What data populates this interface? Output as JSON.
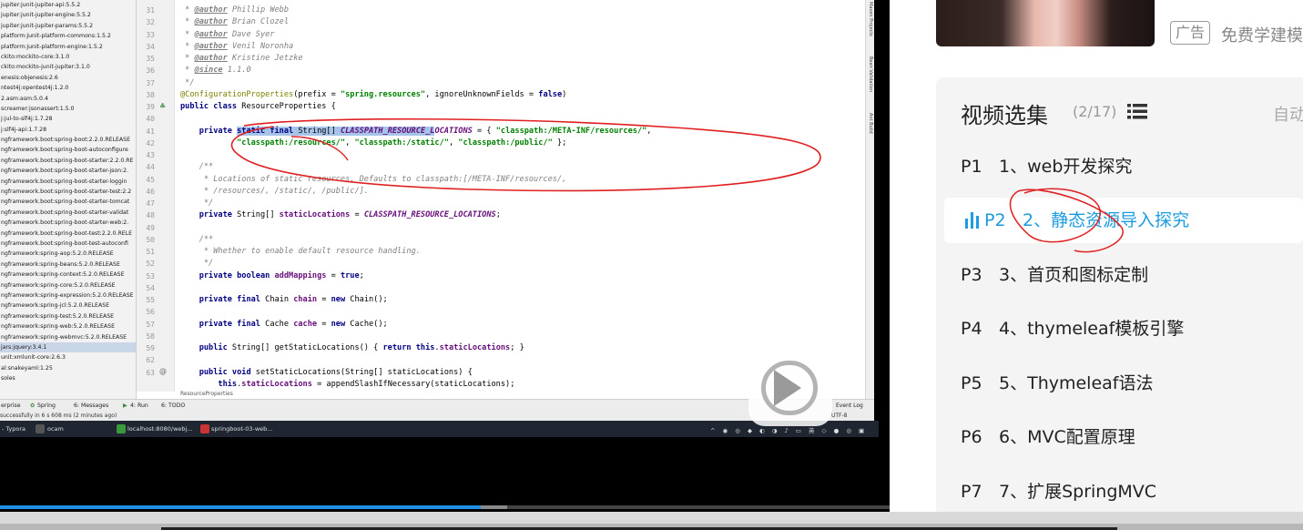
{
  "project_libraries": [
    "jupiter:junit-jupiter-api:5.5.2",
    "jupiter:junit-jupiter-engine:5.5.2",
    "jupiter:junit-jupiter-params:5.5.2",
    "platform:junit-platform-commons:1.5.2",
    "platform:junit-platform-engine:1.5.2",
    "ckito:mockito-core:3.1.0",
    "ckito:mockito-junit-jupiter:3.1.0",
    "enesis:objenesis:2.6",
    "ntest4j:opentest4j:1.2.0",
    "2.asm:asm:5.0.4",
    "screamer:jsonassert:1.5.0",
    "j:jul-to-slf4j:1.7.28",
    "j:slf4j-api:1.7.28",
    "ngframework.boot:spring-boot:2.2.0.RELEASE",
    "ngframework.boot:spring-boot-autoconfigure",
    "ngframework.boot:spring-boot-starter:2.2.0.RE",
    "ngframework.boot:spring-boot-starter-json:2.",
    "ngframework.boot:spring-boot-starter-loggin",
    "ngframework.boot:spring-boot-starter-test:2.2",
    "ngframework.boot:spring-boot-starter-tomcat",
    "ngframework.boot:spring-boot-starter-validat",
    "ngframework.boot:spring-boot-starter-web:2.",
    "ngframework.boot:spring-boot-test:2.2.0.RELE",
    "ngframework.boot:spring-boot-test-autoconfi",
    "ngframework:spring-aop:5.2.0.RELEASE",
    "ngframework:spring-beans:5.2.0.RELEASE",
    "ngframework:spring-context:5.2.0.RELEASE",
    "ngframework:spring-core:5.2.0.RELEASE",
    "ngframework:spring-expression:5.2.0.RELEASE",
    "ngframework:spring-jcl:5.2.0.RELEASE",
    "ngframework:spring-test:5.2.0.RELEASE",
    "ngframework:spring-web:5.2.0.RELEASE",
    "ngframework:spring-webmvc:5.2.0.RELEASE",
    "jars:jquery:3.4.1",
    "unit:xmlunit-core:2.6.3",
    "al:snakeyaml:1.25",
    "soles"
  ],
  "editor": {
    "line_numbers": [
      "31",
      "32",
      "33",
      "34",
      "35",
      "36",
      "37",
      "38",
      "39",
      "40",
      "41",
      "42",
      "43",
      "44",
      "45",
      "46",
      "47",
      "48",
      "49",
      "50",
      "51",
      "52",
      "53",
      "54",
      "55",
      "56",
      "57",
      "58",
      "59",
      "62",
      "63"
    ],
    "authors": [
      "Phillip Webb",
      "Brian Clozel",
      "Dave Syer",
      "Venil Noronha",
      "Kristine Jetzke"
    ],
    "author_tag": "@author",
    "since_tag": "@since",
    "since_value": "1.1.0",
    "annotation": "@ConfigurationProperties",
    "prefix_value": "\"spring.resources\"",
    "class_name": "ResourceProperties",
    "constant": "CLASSPATH_RESOURCE_LOCATIONS",
    "loc1": "\"classpath:/META-INF/resources/\"",
    "loc2": "\"classpath:/resources/\"",
    "loc3": "\"classpath:/static/\"",
    "loc4": "\"classpath:/public/\"",
    "doc1": " * Locations of static resources. Defaults to classpath:[/META-INF/resources/,",
    "doc2": " * /resources/, /static/, /public/].",
    "doc3": " * Whether to enable default resource handling.",
    "breadcrumb": "ResourceProperties"
  },
  "ide_toolbar": {
    "items": [
      "erprise",
      "Spring",
      "6: Messages",
      "4: Run",
      "6: TODO"
    ],
    "event_log": "Event Log",
    "status": "successfully in 6 s 608 ms (2 minutes ago)",
    "encoding": "UTF-8"
  },
  "side_tabs": [
    "Maven Projects",
    "Bean Validation",
    "Ant Build"
  ],
  "taskbar": {
    "items": [
      "- Typora",
      "ocam",
      "localhost:8080/webj...",
      "springboot-03-web..."
    ]
  },
  "player": {
    "progress": 0.54,
    "buffered": 0.57
  },
  "ad": {
    "badge": "广告",
    "text": "免费学建模"
  },
  "playlist": {
    "title": "视频选集",
    "count": "(2/17)",
    "auto": "自动",
    "episodes": [
      {
        "p": "P1",
        "title": "1、web开发探究"
      },
      {
        "p": "P2",
        "title": "2、静态资源导入探究"
      },
      {
        "p": "P3",
        "title": "3、首页和图标定制"
      },
      {
        "p": "P4",
        "title": "4、thymeleaf模板引擎"
      },
      {
        "p": "P5",
        "title": "5、Thymeleaf语法"
      },
      {
        "p": "P6",
        "title": "6、MVC配置原理"
      },
      {
        "p": "P7",
        "title": "7、扩展SpringMVC"
      }
    ],
    "active_index": 1
  },
  "colors": {
    "accent": "#1d9be0",
    "annotation_red": "#e02020",
    "progress_blue": "#1e8ee6"
  }
}
